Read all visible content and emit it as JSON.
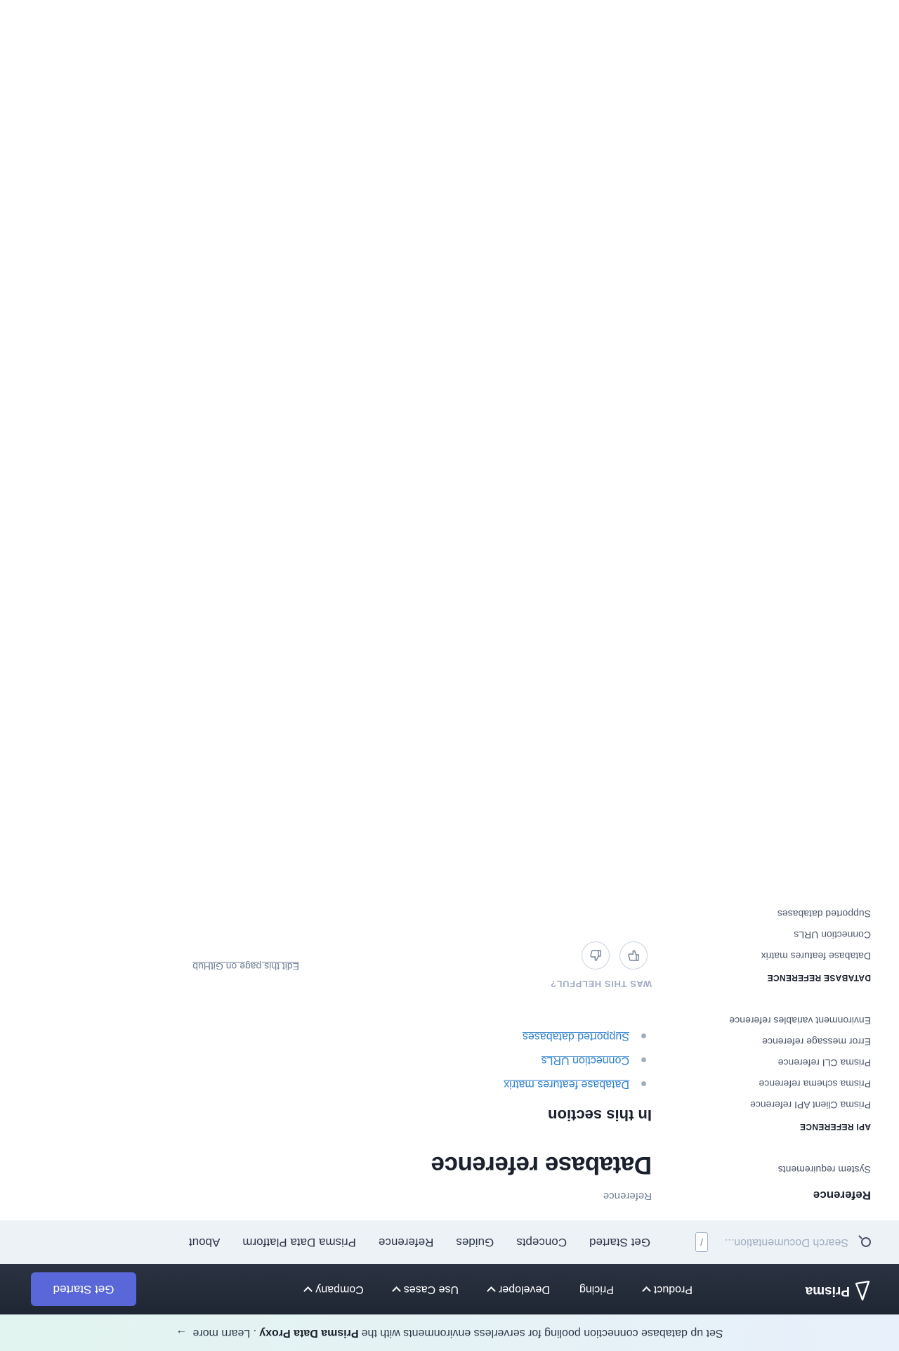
{
  "banner": {
    "text_before": "Set up database connection pooling for serverless environments with the",
    "highlight": "Prisma Data Proxy",
    "text_after": ". Learn more",
    "arrow": "→"
  },
  "topnav": {
    "logo_text": "Prisma",
    "links": [
      {
        "label": "Product",
        "dropdown": true
      },
      {
        "label": "Pricing",
        "dropdown": false
      },
      {
        "label": "Developer",
        "dropdown": true
      },
      {
        "label": "Use Cases",
        "dropdown": true
      },
      {
        "label": "Company",
        "dropdown": true
      }
    ],
    "cta_label": "Get Started"
  },
  "subnav": {
    "search_placeholder": "Search Documentation...",
    "search_shortcut": "/",
    "tabs": [
      "Get Started",
      "Concepts",
      "Guides",
      "Reference",
      "Prisma Data Platform",
      "About"
    ]
  },
  "sidebar": {
    "title": "Reference",
    "top_items": [
      "System requirements"
    ],
    "api_heading": "API REFERENCE",
    "api_items": [
      "Prisma Client API reference",
      "Prisma schema reference",
      "Prisma CLI reference",
      "Error message reference",
      "Environment variables reference"
    ],
    "db_heading": "DATABASE REFERENCE",
    "db_items": [
      "Database features matrix",
      "Connection URLs",
      "Supported databases"
    ]
  },
  "main": {
    "breadcrumb": "Reference",
    "title": "Database reference",
    "section_heading": "In this section",
    "links": [
      "Database features matrix",
      "Connection URLs",
      "Supported databases"
    ],
    "helpful_label": "WAS THIS HELPFUL?",
    "edit_label": "Edit this page on GitHub"
  },
  "colors": {
    "nav_bg": "#1f2633",
    "cta": "#5a67d8",
    "subnav_bg": "#edf2f7",
    "link": "#3182ce"
  }
}
